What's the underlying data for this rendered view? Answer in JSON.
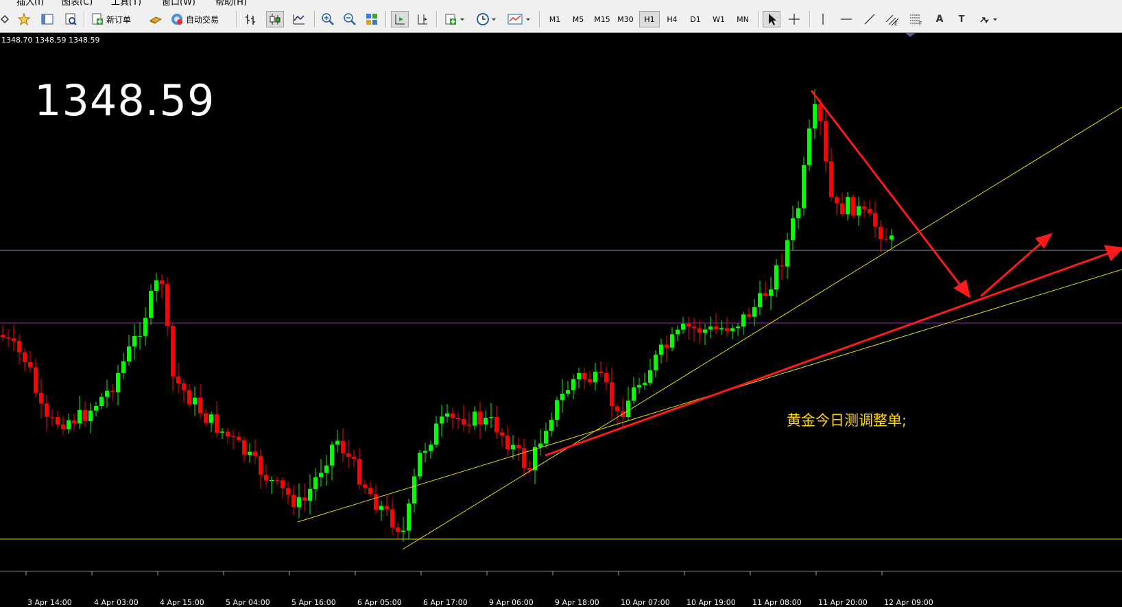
{
  "menu": [
    "插入(I)",
    "图表(C)",
    "工具(T)",
    "窗口(W)",
    "帮助(H)"
  ],
  "toolbar": {
    "new_order_label": "新订单",
    "auto_trading_label": "自动交易",
    "timeframes": [
      "M1",
      "M5",
      "M15",
      "M30",
      "H1",
      "H4",
      "D1",
      "W1",
      "MN"
    ],
    "active_timeframe": "H1",
    "text_tool_label": "A",
    "label_tool_label": "T"
  },
  "chart": {
    "ohlc_readout": "1348.70 1348.59 1348.59",
    "current_price": "1348.59",
    "annotation": "黄金今日测调整单;",
    "background": "#000000",
    "bull_color": "#00ff00",
    "bear_color": "#ff0000",
    "trendline_color": "#ffff00",
    "arrow_color": "#ff0000",
    "x_labels": [
      "3 Apr 14:00",
      "4 Apr 03:00",
      "4 Apr 15:00",
      "5 Apr 04:00",
      "5 Apr 16:00",
      "6 Apr 05:00",
      "6 Apr 17:00",
      "9 Apr 06:00",
      "9 Apr 18:00",
      "10 Apr 07:00",
      "10 Apr 19:00",
      "11 Apr 08:00",
      "11 Apr 20:00",
      "12 Apr 09:00"
    ]
  }
}
